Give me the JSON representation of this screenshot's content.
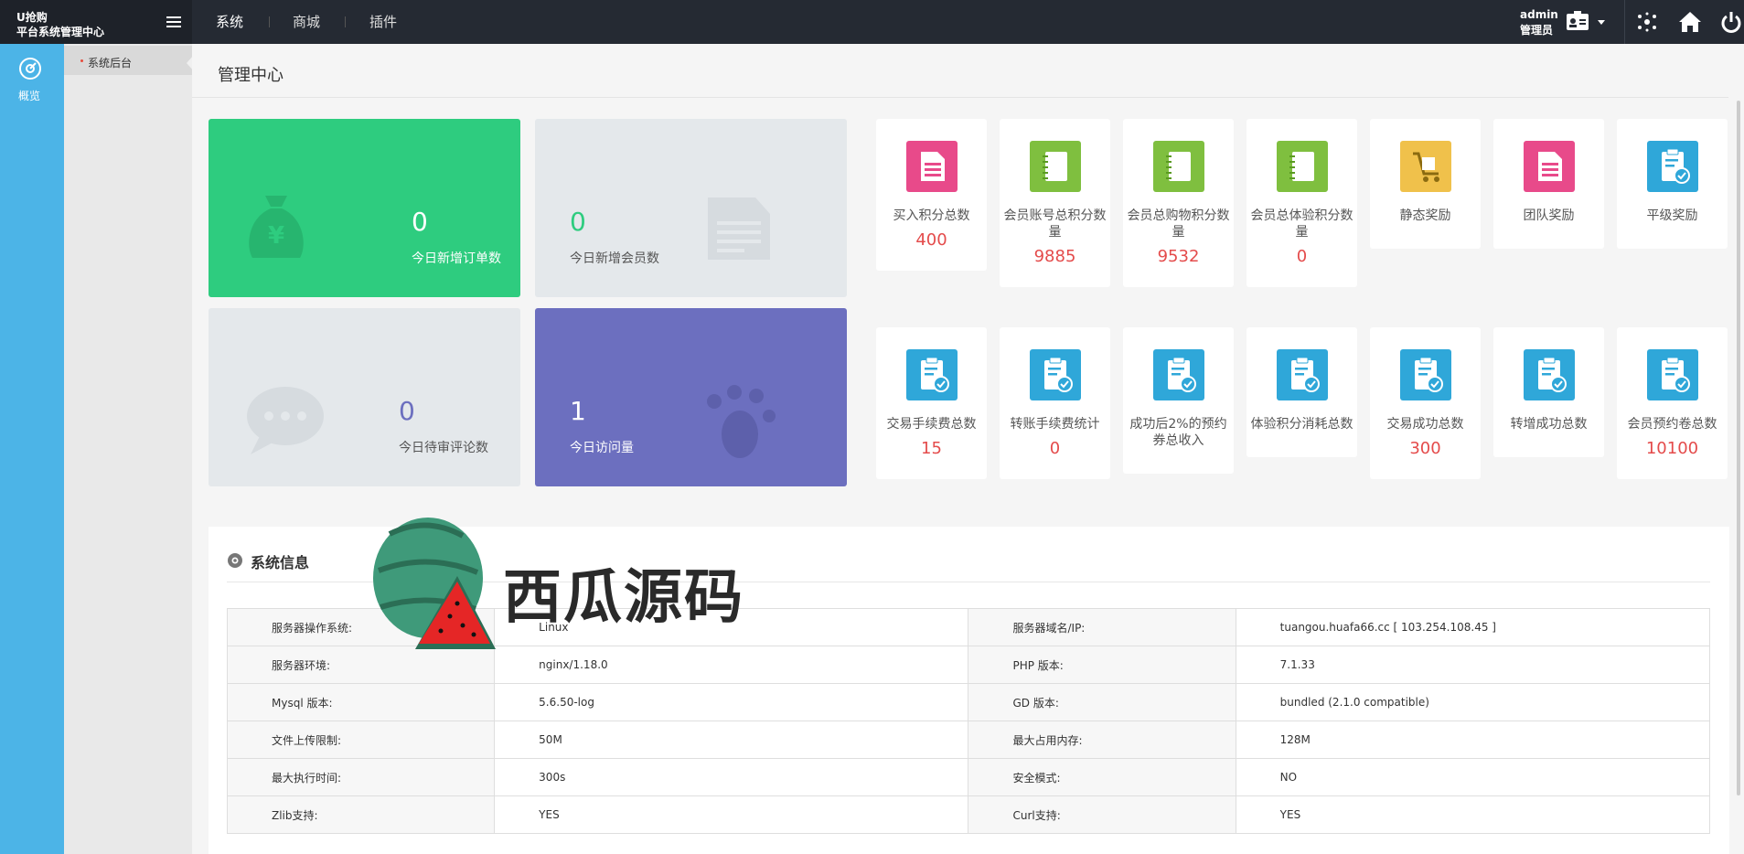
{
  "brand": {
    "line1": "U抢购",
    "line2": "平台系统管理中心"
  },
  "nav": {
    "items": [
      "系统",
      "商城",
      "插件"
    ],
    "active": "系统"
  },
  "user": {
    "name": "admin",
    "role": "管理员"
  },
  "sidebar": {
    "rail_label": "概览",
    "submenu_item": "系统后台"
  },
  "page": {
    "title": "管理中心"
  },
  "big_cards": [
    {
      "value": "0",
      "label": "今日新增订单数",
      "color": "#2ecc7f"
    },
    {
      "value": "0",
      "label": "今日新增会员数",
      "color": "#e4e8eb"
    },
    {
      "value": "0",
      "label": "今日待审评论数",
      "color": "#e4e8eb"
    },
    {
      "value": "1",
      "label": "今日访问量",
      "color": "#6c6fbf"
    }
  ],
  "stats_row1": [
    {
      "label": "买入积分总数",
      "value": "400",
      "icon": "document-icon",
      "color": "#e84a8a"
    },
    {
      "label": "会员账号总积分数量",
      "value": "9885",
      "icon": "notebook-icon",
      "color": "#7fbf3f"
    },
    {
      "label": "会员总购物积分数量",
      "value": "9532",
      "icon": "notebook-icon",
      "color": "#7fbf3f"
    },
    {
      "label": "会员总体验积分数量",
      "value": "0",
      "icon": "notebook-icon",
      "color": "#7fbf3f"
    },
    {
      "label": "静态奖励",
      "value": "",
      "icon": "cart-icon",
      "color": "#f0c14b"
    },
    {
      "label": "团队奖励",
      "value": "",
      "icon": "document-icon",
      "color": "#e84a8a"
    },
    {
      "label": "平级奖励",
      "value": "",
      "icon": "clipboard-check-icon",
      "color": "#2fa7d9"
    }
  ],
  "stats_row2": [
    {
      "label": "交易手续费总数",
      "value": "15",
      "icon": "clipboard-check-icon",
      "color": "#2fa7d9"
    },
    {
      "label": "转账手续费统计",
      "value": "0",
      "icon": "clipboard-check-icon",
      "color": "#2fa7d9"
    },
    {
      "label": "成功后2%的预约券总收入",
      "value": "",
      "icon": "clipboard-check-icon",
      "color": "#2fa7d9"
    },
    {
      "label": "体验积分消耗总数",
      "value": "",
      "icon": "clipboard-check-icon",
      "color": "#2fa7d9"
    },
    {
      "label": "交易成功总数",
      "value": "300",
      "icon": "clipboard-check-icon",
      "color": "#2fa7d9"
    },
    {
      "label": "转增成功总数",
      "value": "",
      "icon": "clipboard-check-icon",
      "color": "#2fa7d9"
    },
    {
      "label": "会员预约卷总数",
      "value": "10100",
      "icon": "clipboard-check-icon",
      "color": "#2fa7d9"
    }
  ],
  "system_info": {
    "title": "系统信息",
    "rows": [
      [
        "服务器操作系统:",
        "Linux",
        "服务器域名/IP:",
        "tuangou.huafa66.cc [ 103.254.108.45 ]"
      ],
      [
        "服务器环境:",
        "nginx/1.18.0",
        "PHP 版本:",
        "7.1.33"
      ],
      [
        "Mysql 版本:",
        "5.6.50-log",
        "GD 版本:",
        "bundled (2.1.0 compatible)"
      ],
      [
        "文件上传限制:",
        "50M",
        "最大占用内存:",
        "128M"
      ],
      [
        "最大执行时间:",
        "300s",
        "安全模式:",
        "NO"
      ],
      [
        "Zlib支持:",
        "YES",
        "Curl支持:",
        "YES"
      ]
    ]
  },
  "watermark": {
    "text": "西瓜源码"
  }
}
